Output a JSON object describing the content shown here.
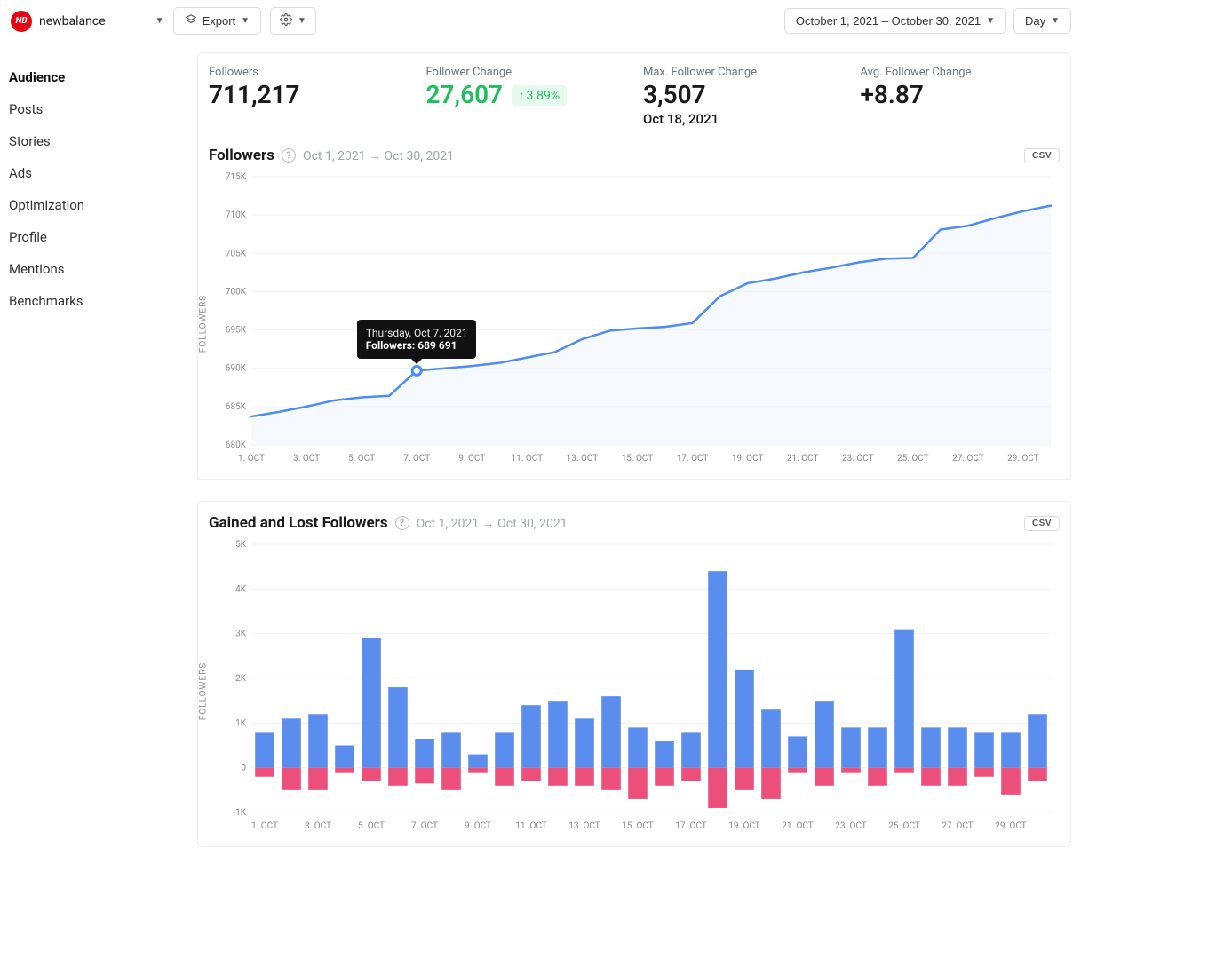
{
  "header": {
    "brand": "newbalance",
    "export_label": "Export",
    "date_range": "October 1, 2021 – October 30, 2021",
    "granularity": "Day"
  },
  "sidebar": {
    "items": [
      {
        "label": "Audience",
        "active": true
      },
      {
        "label": "Posts"
      },
      {
        "label": "Stories"
      },
      {
        "label": "Ads"
      },
      {
        "label": "Optimization"
      },
      {
        "label": "Profile"
      },
      {
        "label": "Mentions"
      },
      {
        "label": "Benchmarks"
      }
    ]
  },
  "metrics": {
    "followers": {
      "label": "Followers",
      "value": "711,217"
    },
    "change": {
      "label": "Follower Change",
      "value": "27,607",
      "delta": "3.89%"
    },
    "max": {
      "label": "Max. Follower Change",
      "value": "3,507",
      "sub": "Oct 18, 2021"
    },
    "avg": {
      "label": "Avg. Follower Change",
      "value": "+8.87"
    }
  },
  "followers_panel": {
    "title": "Followers",
    "date_range": "Oct 1, 2021 → Oct 30, 2021",
    "csv_label": "CSV",
    "ylabel": "FOLLOWERS",
    "tooltip": {
      "line1": "Thursday, Oct 7, 2021",
      "line2": "Followers: 689 691"
    }
  },
  "gained_panel": {
    "title": "Gained and Lost Followers",
    "date_range": "Oct 1, 2021 → Oct 30, 2021",
    "csv_label": "CSV",
    "ylabel": "FOLLOWERS"
  },
  "chart_data": [
    {
      "type": "line",
      "title": "Followers",
      "xlabel": "",
      "ylabel": "FOLLOWERS",
      "ylim": [
        680000,
        715000
      ],
      "x_ticks": [
        "1. OCT",
        "3. OCT",
        "5. OCT",
        "7. OCT",
        "9. OCT",
        "11. OCT",
        "13. OCT",
        "15. OCT",
        "17. OCT",
        "19. OCT",
        "21. OCT",
        "23. OCT",
        "25. OCT",
        "27. OCT",
        "29. OCT"
      ],
      "y_ticks": [
        "680K",
        "685K",
        "690K",
        "695K",
        "700K",
        "705K",
        "710K",
        "715K"
      ],
      "x": [
        "Oct 1",
        "Oct 2",
        "Oct 3",
        "Oct 4",
        "Oct 5",
        "Oct 6",
        "Oct 7",
        "Oct 8",
        "Oct 9",
        "Oct 10",
        "Oct 11",
        "Oct 12",
        "Oct 13",
        "Oct 14",
        "Oct 15",
        "Oct 16",
        "Oct 17",
        "Oct 18",
        "Oct 19",
        "Oct 20",
        "Oct 21",
        "Oct 22",
        "Oct 23",
        "Oct 24",
        "Oct 25",
        "Oct 26",
        "Oct 27",
        "Oct 28",
        "Oct 29",
        "Oct 30"
      ],
      "values": [
        683700,
        684300,
        685000,
        685800,
        686200,
        686400,
        689691,
        690000,
        690300,
        690700,
        691400,
        692100,
        693800,
        694900,
        695200,
        695400,
        695900,
        699400,
        701100,
        701700,
        702500,
        703100,
        703800,
        704300,
        704400,
        708100,
        708600,
        709600,
        710500,
        711217
      ],
      "highlight": {
        "index": 6,
        "date_label": "Thursday, Oct 7, 2021",
        "value_label": "Followers: 689 691"
      }
    },
    {
      "type": "bar",
      "title": "Gained and Lost Followers",
      "xlabel": "",
      "ylabel": "FOLLOWERS",
      "ylim": [
        -1000,
        5000
      ],
      "x_ticks": [
        "1. OCT",
        "3. OCT",
        "5. OCT",
        "7. OCT",
        "9. OCT",
        "11. OCT",
        "13. OCT",
        "15. OCT",
        "17. OCT",
        "19. OCT",
        "21. OCT",
        "23. OCT",
        "25. OCT",
        "27. OCT",
        "29. OCT"
      ],
      "y_ticks": [
        "-1K",
        "0",
        "1K",
        "2K",
        "3K",
        "4K",
        "5K"
      ],
      "categories": [
        "Oct 1",
        "Oct 2",
        "Oct 3",
        "Oct 4",
        "Oct 5",
        "Oct 6",
        "Oct 7",
        "Oct 8",
        "Oct 9",
        "Oct 10",
        "Oct 11",
        "Oct 12",
        "Oct 13",
        "Oct 14",
        "Oct 15",
        "Oct 16",
        "Oct 17",
        "Oct 18",
        "Oct 19",
        "Oct 20",
        "Oct 21",
        "Oct 22",
        "Oct 23",
        "Oct 24",
        "Oct 25",
        "Oct 26",
        "Oct 27",
        "Oct 28",
        "Oct 29",
        "Oct 30"
      ],
      "series": [
        {
          "name": "Gained",
          "color": "#5b8def",
          "values": [
            800,
            1100,
            1200,
            500,
            2900,
            1800,
            650,
            800,
            300,
            800,
            1400,
            1500,
            1100,
            1600,
            900,
            600,
            800,
            4400,
            2200,
            1300,
            700,
            1500,
            900,
            900,
            3100,
            900,
            900,
            800,
            800,
            1200
          ]
        },
        {
          "name": "Lost",
          "color": "#ec4f7a",
          "values": [
            -200,
            -500,
            -500,
            -100,
            -300,
            -400,
            -350,
            -500,
            -100,
            -400,
            -300,
            -400,
            -400,
            -500,
            -700,
            -400,
            -300,
            -900,
            -500,
            -700,
            -100,
            -400,
            -100,
            -400,
            -100,
            -400,
            -400,
            -200,
            -600,
            -300
          ]
        }
      ]
    }
  ]
}
